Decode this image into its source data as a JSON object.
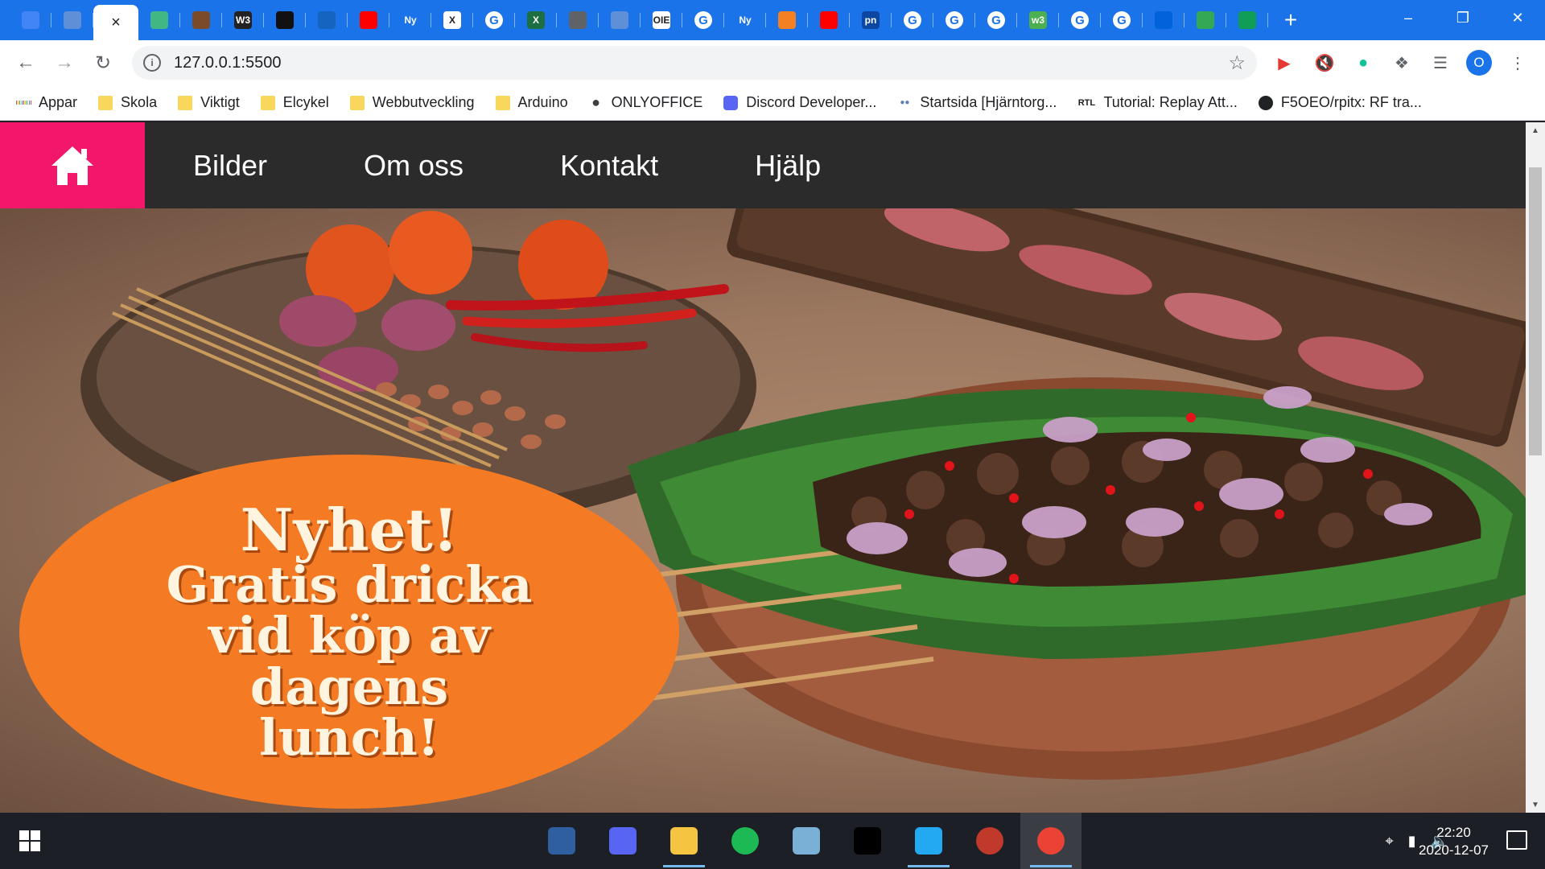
{
  "tabs": [
    {
      "icon": "docs-icon",
      "label": "",
      "color": "#4285f4"
    },
    {
      "icon": "globe-icon",
      "label": "",
      "color": "#5f8fd6"
    },
    {
      "icon": "close-icon",
      "label": "×",
      "active": true
    },
    {
      "icon": "vue-icon",
      "label": "",
      "color": "#41b883"
    },
    {
      "icon": "image-icon",
      "label": "",
      "color": "#7a4a2a"
    },
    {
      "icon": "w3schools-icon",
      "label": "W3",
      "color": "#222222"
    },
    {
      "icon": "puzzle-app-icon",
      "label": "",
      "color": "#111111"
    },
    {
      "icon": "contacts-icon",
      "label": "",
      "color": "#1565c0"
    },
    {
      "icon": "youtube-icon",
      "label": "",
      "color": "#ff0000"
    },
    {
      "icon": "new-tab-icon",
      "label": "Ny",
      "color": "#1a73e8"
    },
    {
      "icon": "xcode-icon",
      "label": "X",
      "color": "#ffffff"
    },
    {
      "icon": "google-icon",
      "label": "G"
    },
    {
      "icon": "excel-icon",
      "label": "X",
      "color": "#1d6f42"
    },
    {
      "icon": "wrench-icon",
      "label": "",
      "color": "#5f6368"
    },
    {
      "icon": "globe-icon",
      "label": "",
      "color": "#5f8fd6"
    },
    {
      "icon": "oie-icon",
      "label": "OIE",
      "color": "#ffffff"
    },
    {
      "icon": "google-icon",
      "label": "G"
    },
    {
      "icon": "new-tab-icon",
      "label": "Ny",
      "color": "#1a73e8"
    },
    {
      "icon": "stackoverflow-icon",
      "label": "",
      "color": "#f48024"
    },
    {
      "icon": "youtube-icon",
      "label": "",
      "color": "#ff0000"
    },
    {
      "icon": "pn-icon",
      "label": "pn",
      "color": "#0d47a1"
    },
    {
      "icon": "google-icon",
      "label": "G"
    },
    {
      "icon": "google-icon",
      "label": "G"
    },
    {
      "icon": "google-icon",
      "label": "G"
    },
    {
      "icon": "w3-green-icon",
      "label": "w3",
      "color": "#4caf50"
    },
    {
      "icon": "google-icon",
      "label": "G"
    },
    {
      "icon": "google-icon",
      "label": "G"
    },
    {
      "icon": "flickr-icon",
      "label": "",
      "color": "#0063dc"
    },
    {
      "icon": "layers-icon",
      "label": "",
      "color": "#34a853"
    },
    {
      "icon": "sheets-icon",
      "label": "",
      "color": "#0f9d58"
    }
  ],
  "newtab_label": "+",
  "window": {
    "minimize": "–",
    "restore": "❐",
    "close": "✕"
  },
  "address": {
    "url": "127.0.0.1:5500"
  },
  "bookmarks": [
    {
      "label": "Appar",
      "icon": "apps-icon"
    },
    {
      "label": "Skola",
      "icon": "folder-icon"
    },
    {
      "label": "Viktigt",
      "icon": "folder-icon"
    },
    {
      "label": "Elcykel",
      "icon": "folder-icon"
    },
    {
      "label": "Webbutveckling",
      "icon": "folder-icon"
    },
    {
      "label": "Arduino",
      "icon": "folder-icon"
    },
    {
      "label": "ONLYOFFICE",
      "icon": "globe-icon"
    },
    {
      "label": "Discord Developer...",
      "icon": "discord-icon"
    },
    {
      "label": "Startsida [Hjärntorg...",
      "icon": "dots-icon"
    },
    {
      "label": "Tutorial: Replay Att...",
      "icon": "rtl-icon",
      "glyph": "RTL"
    },
    {
      "label": "F5OEO/rpitx: RF tra...",
      "icon": "github-icon"
    }
  ],
  "site": {
    "nav": [
      "Bilder",
      "Om oss",
      "Kontakt",
      "Hjälp"
    ],
    "accent": "#f2176b",
    "promo": {
      "line1": "Nyhet!",
      "line2": "Gratis dricka",
      "line3": "vid köp av",
      "line4": "dagens",
      "line5": "lunch!"
    }
  },
  "taskbar": {
    "apps": [
      {
        "icon": "calculator-icon",
        "color": "#2f5f9e"
      },
      {
        "icon": "discord-icon",
        "color": "#5865f2"
      },
      {
        "icon": "file-explorer-icon",
        "color": "#f5c542"
      },
      {
        "icon": "spotify-icon",
        "color": "#1db954"
      },
      {
        "icon": "notes-icon",
        "color": "#7ab0d6"
      },
      {
        "icon": "unity-icon",
        "color": "#000000"
      },
      {
        "icon": "vscode-icon",
        "color": "#23a9f2"
      },
      {
        "icon": "game-icon",
        "color": "#c0392b"
      },
      {
        "icon": "chrome-icon",
        "color": "#ea4335"
      }
    ],
    "time": "22:20",
    "date": "2020-12-07"
  }
}
